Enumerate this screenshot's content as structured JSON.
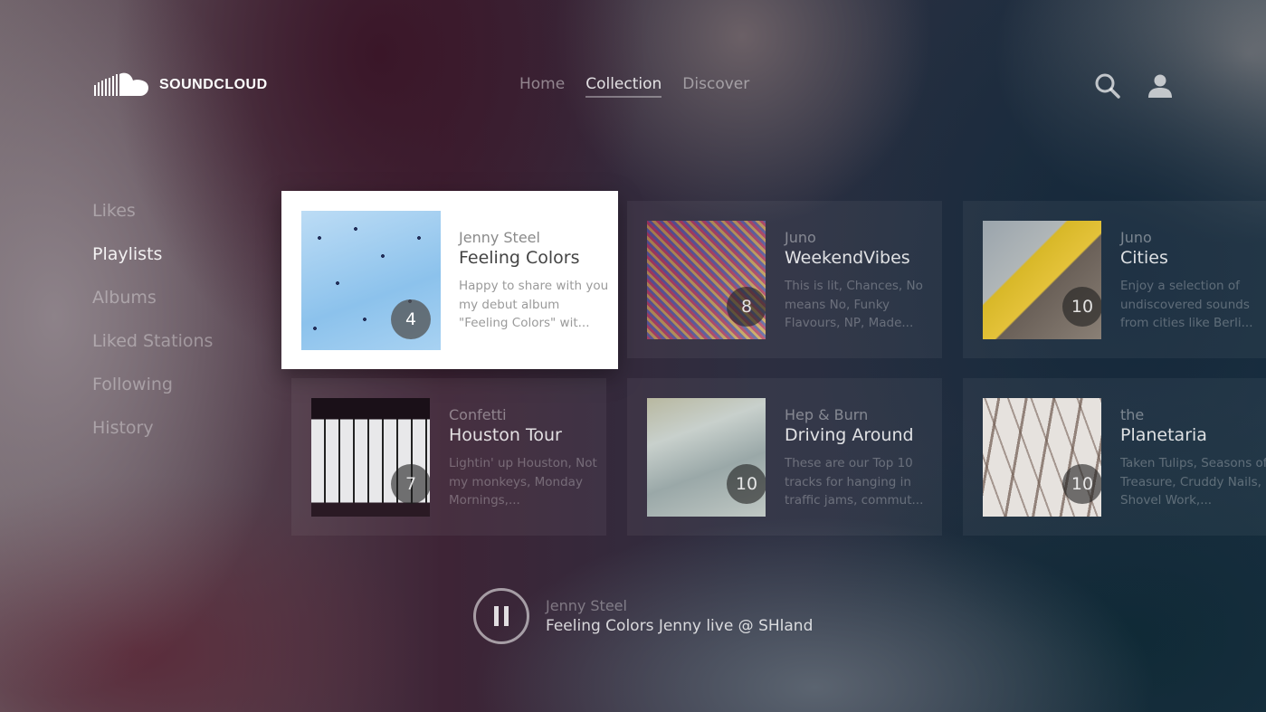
{
  "app": {
    "name": "SOUNDCLOUD"
  },
  "topnav": {
    "items": [
      {
        "label": "Home",
        "active": false
      },
      {
        "label": "Collection",
        "active": true
      },
      {
        "label": "Discover",
        "active": false
      }
    ],
    "search_icon": "search-icon",
    "profile_icon": "user-icon"
  },
  "sidebar": {
    "items": [
      {
        "label": "Likes",
        "active": false
      },
      {
        "label": "Playlists",
        "active": true
      },
      {
        "label": "Albums",
        "active": false
      },
      {
        "label": "Liked Stations",
        "active": false
      },
      {
        "label": "Following",
        "active": false
      },
      {
        "label": "History",
        "active": false
      }
    ]
  },
  "playlists": [
    {
      "artist": "Jenny Steel",
      "title": "Feeling Colors",
      "description": "Happy to share with you my debut album \"Feeling Colors\" wit...",
      "track_count": "4",
      "focused": true,
      "art": "birds-sky"
    },
    {
      "artist": "Juno",
      "title": "WeekendVibes",
      "description": "This is lit, Chances, No means No,  Funky Flavours, NP, Made...",
      "track_count": "8",
      "focused": false,
      "art": "confetti"
    },
    {
      "artist": "Juno",
      "title": "Cities",
      "description": "Enjoy a selection of undiscovered sounds from cities like Berli...",
      "track_count": "10",
      "focused": false,
      "art": "yellow-curb"
    },
    {
      "artist": "Confetti",
      "title": "Houston Tour",
      "description": "Lightin' up Houston, Not my monkeys, Monday Mornings,...",
      "track_count": "7",
      "focused": false,
      "art": "window-silhouette"
    },
    {
      "artist": "Hep & Burn",
      "title": "Driving Around",
      "description": "These are our Top 10 tracks for hanging in traffic jams, commut...",
      "track_count": "10",
      "focused": false,
      "art": "car-window"
    },
    {
      "artist": "the",
      "title": "Planetaria",
      "description": "Taken Tulips, Seasons of Treasure, Cruddy Nails,  Shovel Work,...",
      "track_count": "10",
      "focused": false,
      "art": "thorny-branches"
    }
  ],
  "now_playing": {
    "artist": "Jenny Steel",
    "title": "Feeling Colors Jenny live @ SHland",
    "state": "playing",
    "control_icon": "pause-icon"
  }
}
